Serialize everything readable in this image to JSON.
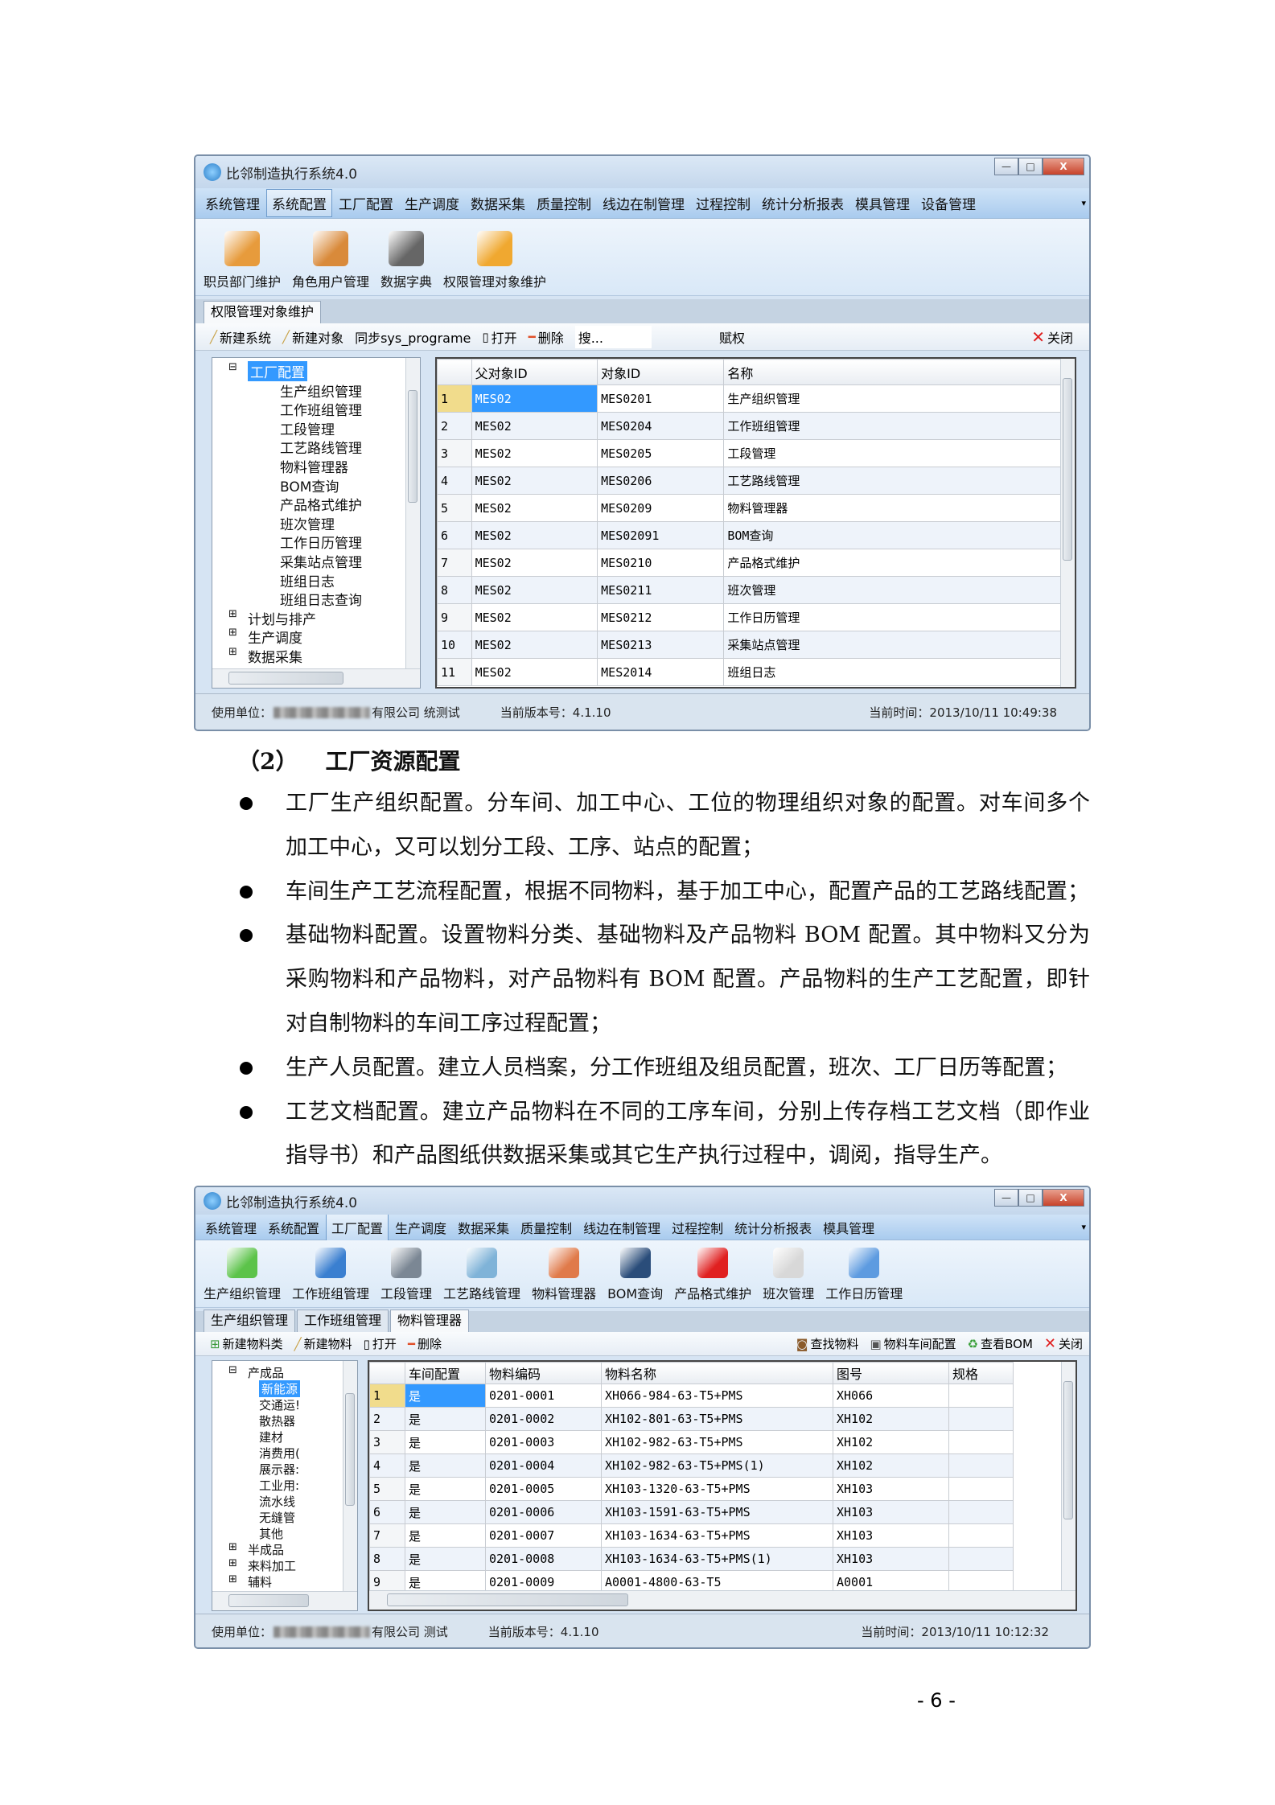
{
  "window1": {
    "title": "比邻制造执行系统4.0",
    "window_buttons": [
      "—",
      "□",
      "X"
    ],
    "menu": [
      "系统管理",
      "系统配置",
      "工厂配置",
      "生产调度",
      "数据采集",
      "质量控制",
      "线边在制管理",
      "过程控制",
      "统计分析报表",
      "模具管理",
      "设备管理"
    ],
    "active_menu": 1,
    "ribbon": [
      {
        "label": "职员部门维护",
        "icon": "staff-icon",
        "color": "#e79b3c"
      },
      {
        "label": "角色用户管理",
        "icon": "users-icon",
        "color": "#d98a3a"
      },
      {
        "label": "数据字典",
        "icon": "book-icon",
        "color": "#666666"
      },
      {
        "label": "权限管理对象维护",
        "icon": "lock-icon",
        "color": "#f0a830"
      }
    ],
    "tabs": [
      "权限管理对象维护"
    ],
    "toolbar": {
      "items": [
        "新建系统",
        "新建对象",
        "同步sys_programe",
        "打开",
        "删除",
        "搜..."
      ],
      "grant": "赋权",
      "close": "关闭"
    },
    "tree": {
      "root": "工厂配置",
      "children": [
        "生产组织管理",
        "工作班组管理",
        "工段管理",
        "工艺路线管理",
        "物料管理器",
        "BOM查询",
        "产品格式维护",
        "班次管理",
        "工作日历管理",
        "采集站点管理",
        "班组日志",
        "班组日志查询"
      ],
      "siblings": [
        "计划与排产",
        "生产调度",
        "数据采集"
      ]
    },
    "grid": {
      "columns": [
        "",
        "父对象ID",
        "对象ID",
        "名称"
      ],
      "rows": [
        [
          "1",
          "MES02",
          "MES0201",
          "生产组织管理"
        ],
        [
          "2",
          "MES02",
          "MES0204",
          "工作班组管理"
        ],
        [
          "3",
          "MES02",
          "MES0205",
          "工段管理"
        ],
        [
          "4",
          "MES02",
          "MES0206",
          "工艺路线管理"
        ],
        [
          "5",
          "MES02",
          "MES0209",
          "物料管理器"
        ],
        [
          "6",
          "MES02",
          "MES02091",
          "BOM查询"
        ],
        [
          "7",
          "MES02",
          "MES0210",
          "产品格式维护"
        ],
        [
          "8",
          "MES02",
          "MES0211",
          "班次管理"
        ],
        [
          "9",
          "MES02",
          "MES0212",
          "工作日历管理"
        ],
        [
          "10",
          "MES02",
          "MES0213",
          "采集站点管理"
        ],
        [
          "11",
          "MES02",
          "MES2014",
          "班组日志"
        ]
      ]
    },
    "status": {
      "unit_label": "使用单位：",
      "unit_suffix": "有限公司 统测试",
      "version": "当前版本号：4.1.10",
      "time": "当前时间：2013/10/11 10:49:38"
    }
  },
  "section": {
    "number": "（2）",
    "title": "工厂资源配置",
    "bullets": [
      [
        "工厂生产组织配置。分车间、加工中心、工位的物理组织对象的配置。对车间多个",
        "加工中心，又可以划分工段、工序、站点的配置；"
      ],
      [
        "车间生产工艺流程配置，根据不同物料，基于加工中心，配置产品的工艺路线配置；"
      ],
      [
        "基础物料配置。设置物料分类、基础物料及产品物料 BOM 配置。其中物料又分为",
        "采购物料和产品物料，对产品物料有 BOM 配置。产品物料的生产工艺配置，即针",
        "对自制物料的车间工序过程配置；"
      ],
      [
        "生产人员配置。建立人员档案，分工作班组及组员配置，班次、工厂日历等配置；"
      ],
      [
        "工艺文档配置。建立产品物料在不同的工序车间，分别上传存档工艺文档（即作业",
        "指导书）和产品图纸供数据采集或其它生产执行过程中，调阅，指导生产。"
      ]
    ]
  },
  "window2": {
    "title": "比邻制造执行系统4.0",
    "window_buttons": [
      "—",
      "□",
      "X"
    ],
    "menu": [
      "系统管理",
      "系统配置",
      "工厂配置",
      "生产调度",
      "数据采集",
      "质量控制",
      "线边在制管理",
      "过程控制",
      "统计分析报表",
      "模具管理"
    ],
    "active_menu": 2,
    "ribbon": [
      {
        "label": "生产组织管理",
        "icon": "plus-icon",
        "color": "#5cc34a"
      },
      {
        "label": "工作班组管理",
        "icon": "person-icon",
        "color": "#3a7fd0"
      },
      {
        "label": "工段管理",
        "icon": "stack-icon",
        "color": "#7b8794"
      },
      {
        "label": "工艺路线管理",
        "icon": "line-chart-icon",
        "color": "#7fb3d8"
      },
      {
        "label": "物料管理器",
        "icon": "hexagon-icon",
        "color": "#e07a4a"
      },
      {
        "label": "BOM查询",
        "icon": "monitor-icon",
        "color": "#2a4d7a"
      },
      {
        "label": "产品格式维护",
        "icon": "flag-icon",
        "color": "#e02020"
      },
      {
        "label": "班次管理",
        "icon": "sheet-icon",
        "color": "#d8d8d8"
      },
      {
        "label": "工作日历管理",
        "icon": "calendar-icon",
        "color": "#5d9be0"
      }
    ],
    "tabs": [
      "生产组织管理",
      "工作班组管理",
      "物料管理器"
    ],
    "active_tab": 2,
    "toolbar": {
      "items": [
        "新建物料类",
        "新建物料",
        "打开",
        "删除"
      ],
      "right": [
        "查找物料",
        "物料车间配置",
        "查看BOM",
        "关闭"
      ]
    },
    "tree": {
      "root": "产成品",
      "children": [
        "新能源",
        "交通运!",
        "散热器",
        "建材",
        "消费用(",
        "展示器:",
        "工业用:",
        "流水线",
        "无缝管",
        "其他"
      ],
      "siblings": [
        "半成品",
        "来料加工",
        "辅料"
      ]
    },
    "grid": {
      "columns": [
        "",
        "车间配置",
        "物料编码",
        "物料名称",
        "图号",
        "规格"
      ],
      "rows": [
        [
          "1",
          "是",
          "0201-0001",
          "XH066-984-63-T5+PMS",
          "XH066",
          ""
        ],
        [
          "2",
          "是",
          "0201-0002",
          "XH102-801-63-T5+PMS",
          "XH102",
          ""
        ],
        [
          "3",
          "是",
          "0201-0003",
          "XH102-982-63-T5+PMS",
          "XH102",
          ""
        ],
        [
          "4",
          "是",
          "0201-0004",
          "XH102-982-63-T5+PMS(1)",
          "XH102",
          ""
        ],
        [
          "5",
          "是",
          "0201-0005",
          "XH103-1320-63-T5+PMS",
          "XH103",
          ""
        ],
        [
          "6",
          "是",
          "0201-0006",
          "XH103-1591-63-T5+PMS",
          "XH103",
          ""
        ],
        [
          "7",
          "是",
          "0201-0007",
          "XH103-1634-63-T5+PMS",
          "XH103",
          ""
        ],
        [
          "8",
          "是",
          "0201-0008",
          "XH103-1634-63-T5+PMS(1)",
          "XH103",
          ""
        ],
        [
          "9",
          "是",
          "0201-0009",
          "A0001-4800-63-T5",
          "A0001",
          ""
        ]
      ]
    },
    "status": {
      "unit_label": "使用单位：",
      "unit_suffix": "有限公司 测试",
      "version": "当前版本号：4.1.10",
      "time": "当前时间：2013/10/11 10:12:32"
    }
  },
  "page_number": "- 6 -"
}
